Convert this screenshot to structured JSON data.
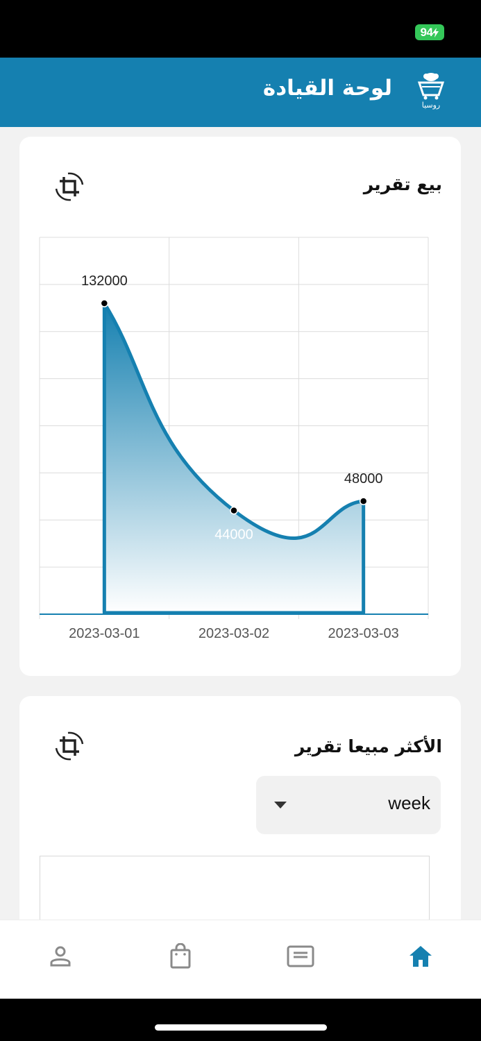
{
  "status_bar": {
    "battery": "94"
  },
  "header": {
    "title": "لوحة القيادة",
    "logo_text": "روسيا"
  },
  "sales_card": {
    "title": "بيع تقرير",
    "refresh_icon": "crop-rotate-icon"
  },
  "best_selling_card": {
    "title": "الأكثر مبيعا تقرير",
    "refresh_icon": "crop-rotate-icon",
    "period_select": {
      "value": "week"
    }
  },
  "chart_data": {
    "type": "area",
    "categories": [
      "2023-03-01",
      "2023-03-02",
      "2023-03-03"
    ],
    "values": [
      132000,
      44000,
      48000
    ],
    "data_labels": [
      "132000",
      "44000",
      "48000"
    ],
    "title": "",
    "xlabel": "",
    "ylabel": "",
    "ylim": [
      0,
      160000
    ],
    "grid": true,
    "colors": {
      "line": "#1580b0",
      "fill_top": "#1580b0",
      "fill_bottom": "#ffffff"
    }
  },
  "bottom_nav": {
    "items": [
      {
        "icon": "person-icon",
        "active": false
      },
      {
        "icon": "shopping-bag-icon",
        "active": false
      },
      {
        "icon": "receipt-icon",
        "active": false
      },
      {
        "icon": "home-icon",
        "active": true
      }
    ]
  },
  "colors": {
    "primary": "#1580b0",
    "inactive_icon": "#8a8a8a"
  }
}
